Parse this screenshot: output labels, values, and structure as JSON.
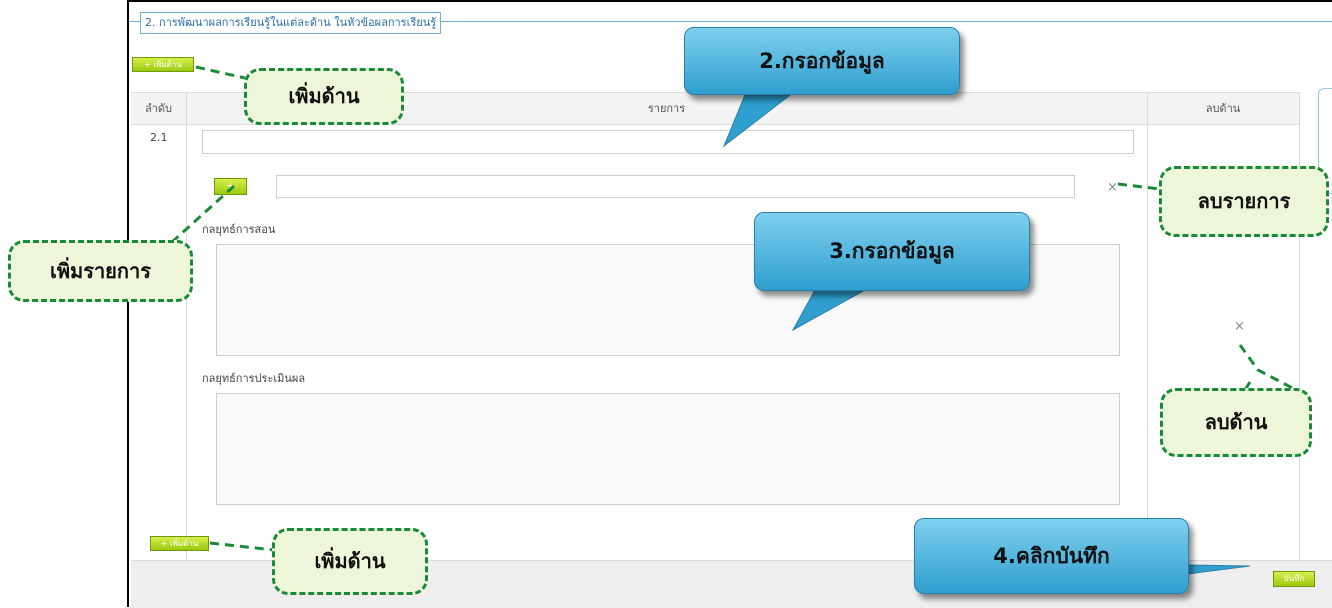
{
  "section": {
    "title": "2. การพัฒนาผลการเรียนรู้ในแต่ละด้าน ในหัวข้อผลการเรียนรู้"
  },
  "buttons": {
    "add_side_top": "+ เพิ่มด้าน",
    "add_item": "+",
    "add_side_bottom": "+ เพิ่มด้าน",
    "save": "บันทึก"
  },
  "table": {
    "columns": [
      "ลำดับ",
      "รายการ",
      "ลบด้าน"
    ],
    "row": {
      "index": "2.1",
      "item_value": "",
      "sub_item_value": "",
      "teaching_label": "กลยุทธ์การสอน",
      "teaching_value": "",
      "assessment_label": "กลยุทธ์การประเมินผล",
      "assessment_value": ""
    }
  },
  "icons": {
    "remove_item": "×",
    "remove_side": "×"
  },
  "annotations": {
    "add_side_top": "เพิ่มด้าน",
    "add_item": "เพิ่มรายการ",
    "remove_item": "ลบรายการ",
    "remove_side": "ลบด้าน",
    "add_side_bottom": "เพิ่มด้าน",
    "step2": "2.กรอกข้อมูล",
    "step3": "3.กรอกข้อมูล",
    "step4": "4.คลิกบันทึก"
  },
  "colors": {
    "accent_green": "#9cc90f",
    "callout_border": "#1a8a3a",
    "bubble_blue": "#2f9fcf",
    "legend_blue": "#2a6db0"
  }
}
